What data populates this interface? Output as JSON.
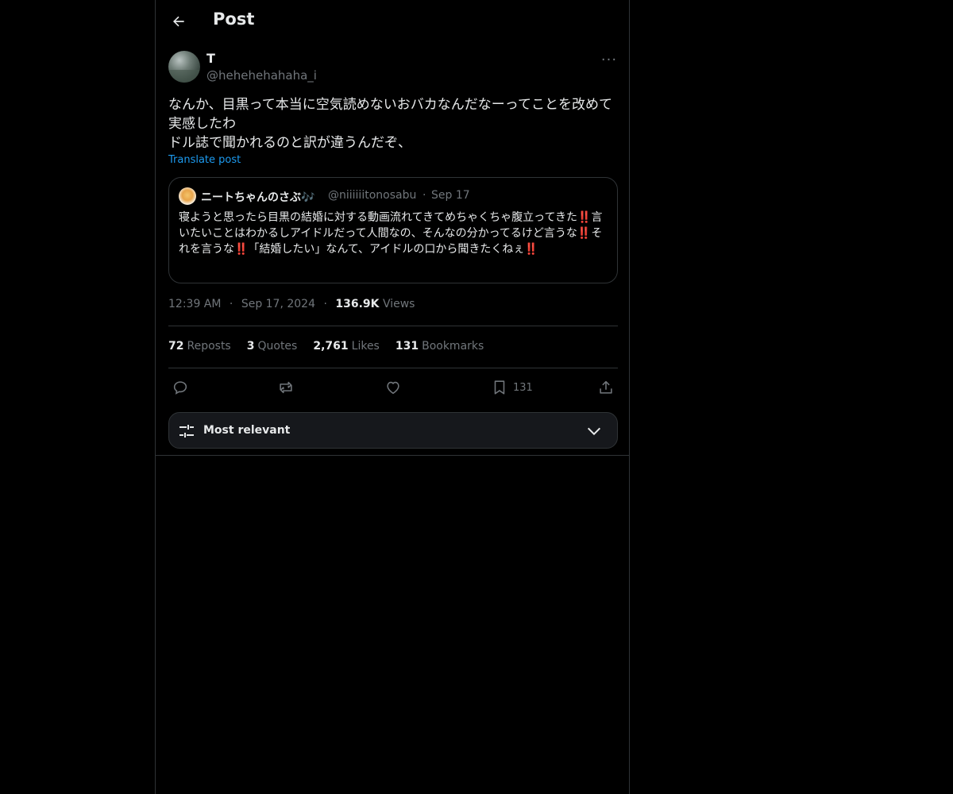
{
  "header": {
    "title": "Post",
    "back_icon": "arrow-left-icon"
  },
  "post": {
    "display_name": "T",
    "handle": "@hehehehahaha_i",
    "more_label": "···",
    "text_lines": [
      "なんか、目黒って本当に空気読めないおバカなんだなーってことを改めて",
      "実感したわ",
      "ドル誌で聞かれるのと訳が違うんだぞ、"
    ],
    "translate_label": "Translate post",
    "time": "12:39 AM",
    "date": "Sep 17, 2024",
    "views_count": "136.9K",
    "views_label": "Views",
    "meta_separator": "·"
  },
  "quote": {
    "display_name": "ニートちゃんのさぶ🎶",
    "handle": "@niiiiiitonosabu",
    "separator": "·",
    "date": "Sep 17",
    "text": "寝ようと思ったら目黒の結婚に対する動画流れてきてめちゃくちゃ腹立ってきた‼️言いたいことはわかるしアイドルだって人間なの、そんなの分かってるけど言うな‼️それを言うな‼️「結婚したい」なんて、アイドルの口から聞きたくねぇ‼️"
  },
  "stats": {
    "reposts_count": "72",
    "reposts_label": "Reposts",
    "quotes_count": "3",
    "quotes_label": "Quotes",
    "likes_count": "2,761",
    "likes_label": "Likes",
    "bookmarks_count": "131",
    "bookmarks_label": "Bookmarks"
  },
  "actions": {
    "bookmark_count": "131"
  },
  "sort": {
    "label": "Most relevant"
  },
  "colors": {
    "background": "#000000",
    "text": "#e7e9ea",
    "muted": "#71767b",
    "accent": "#1d9bf0",
    "border": "#2f3336"
  }
}
